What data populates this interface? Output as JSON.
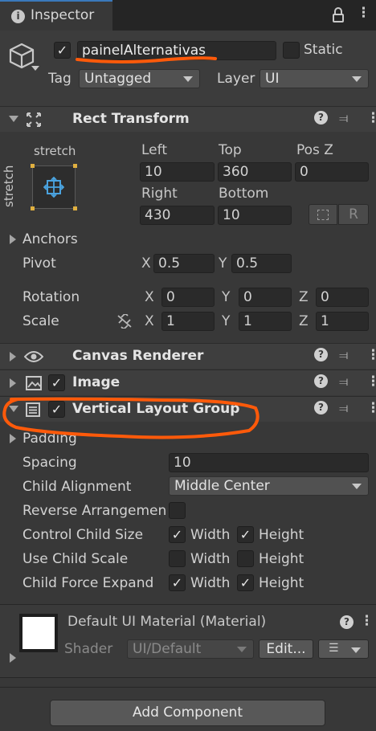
{
  "tab": {
    "title": "Inspector"
  },
  "object": {
    "name": "painelAlternativas",
    "static_label": "Static",
    "tag_label": "Tag",
    "tag_value": "Untagged",
    "layer_label": "Layer",
    "layer_value": "UI",
    "active": true
  },
  "rect_transform": {
    "title": "Rect Transform",
    "anchor_top_label": "stretch",
    "anchor_side_label": "stretch",
    "left_label": "Left",
    "left": "10",
    "top_label": "Top",
    "top": "360",
    "posz_label": "Pos Z",
    "posz": "0",
    "right_label": "Right",
    "right": "430",
    "bottom_label": "Bottom",
    "bottom": "10",
    "raw_button": "R",
    "anchors_label": "Anchors",
    "pivot_label": "Pivot",
    "pivot_x": "0.5",
    "pivot_y": "0.5",
    "rotation_label": "Rotation",
    "rot_x": "0",
    "rot_y": "0",
    "rot_z": "0",
    "scale_label": "Scale",
    "scale_x": "1",
    "scale_y": "1",
    "scale_z": "1",
    "x": "X",
    "y": "Y",
    "z": "Z"
  },
  "canvas_renderer": {
    "title": "Canvas Renderer"
  },
  "image": {
    "title": "Image"
  },
  "vertical_layout": {
    "title": "Vertical Layout Group",
    "padding_label": "Padding",
    "spacing_label": "Spacing",
    "spacing": "10",
    "child_alignment_label": "Child Alignment",
    "child_alignment": "Middle Center",
    "reverse_label": "Reverse Arrangemen",
    "control_size_label": "Control Child Size",
    "use_scale_label": "Use Child Scale",
    "force_expand_label": "Child Force Expand",
    "width": "Width",
    "height": "Height"
  },
  "material": {
    "title": "Default UI Material (Material)",
    "shader_label": "Shader",
    "shader_value": "UI/Default",
    "edit_button": "Edit..."
  },
  "add_component": "Add Component",
  "colors": {
    "annotation": "#ff5a0a",
    "background": "#383838",
    "field": "#2a2a2a",
    "accent": "#4aa3df"
  }
}
